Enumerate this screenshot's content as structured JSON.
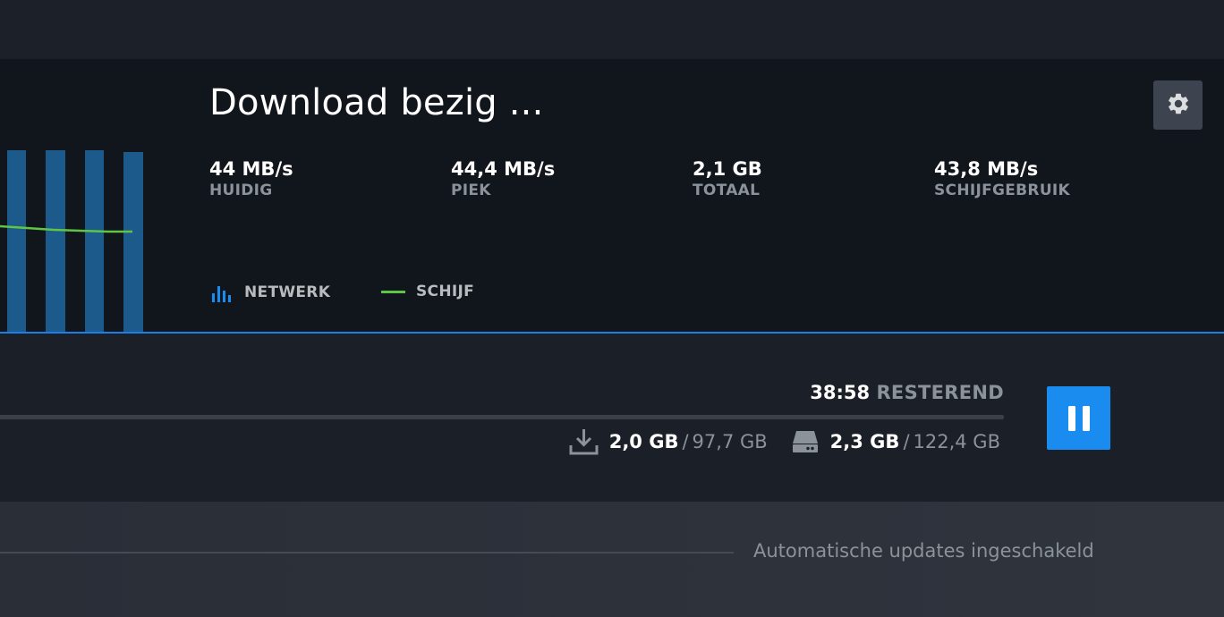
{
  "title": "Download bezig ...",
  "stats": [
    {
      "value": "44 MB/s",
      "label": "HUIDIG"
    },
    {
      "value": "44,4 MB/s",
      "label": "PIEK"
    },
    {
      "value": "2,1 GB",
      "label": "TOTAAL"
    },
    {
      "value": "43,8 MB/s",
      "label": "SCHIJFGEBRUIK"
    }
  ],
  "legend": {
    "network_label": "NETWERK",
    "disk_label": "SCHIJF",
    "network_icon": "bar-chart-icon",
    "disk_icon": "line-icon"
  },
  "colors": {
    "network_bar": "#1b5a8a",
    "disk_line": "#5fc545",
    "accent": "#1a8cf0",
    "divider": "#1a7fe8"
  },
  "progress": {
    "remaining_time": "38:58",
    "remaining_word": "RESTEREND",
    "download_done": "2,0 GB",
    "download_total": "97,7 GB",
    "disk_done": "2,3 GB",
    "disk_total": "122,4 GB",
    "separator": "/",
    "download_icon": "download-icon",
    "disk_icon": "hard-drive-icon"
  },
  "buttons": {
    "settings_icon": "gear-icon",
    "pause_icon": "pause-icon"
  },
  "footer": {
    "auto_updates": "Automatische updates ingeschakeld"
  }
}
